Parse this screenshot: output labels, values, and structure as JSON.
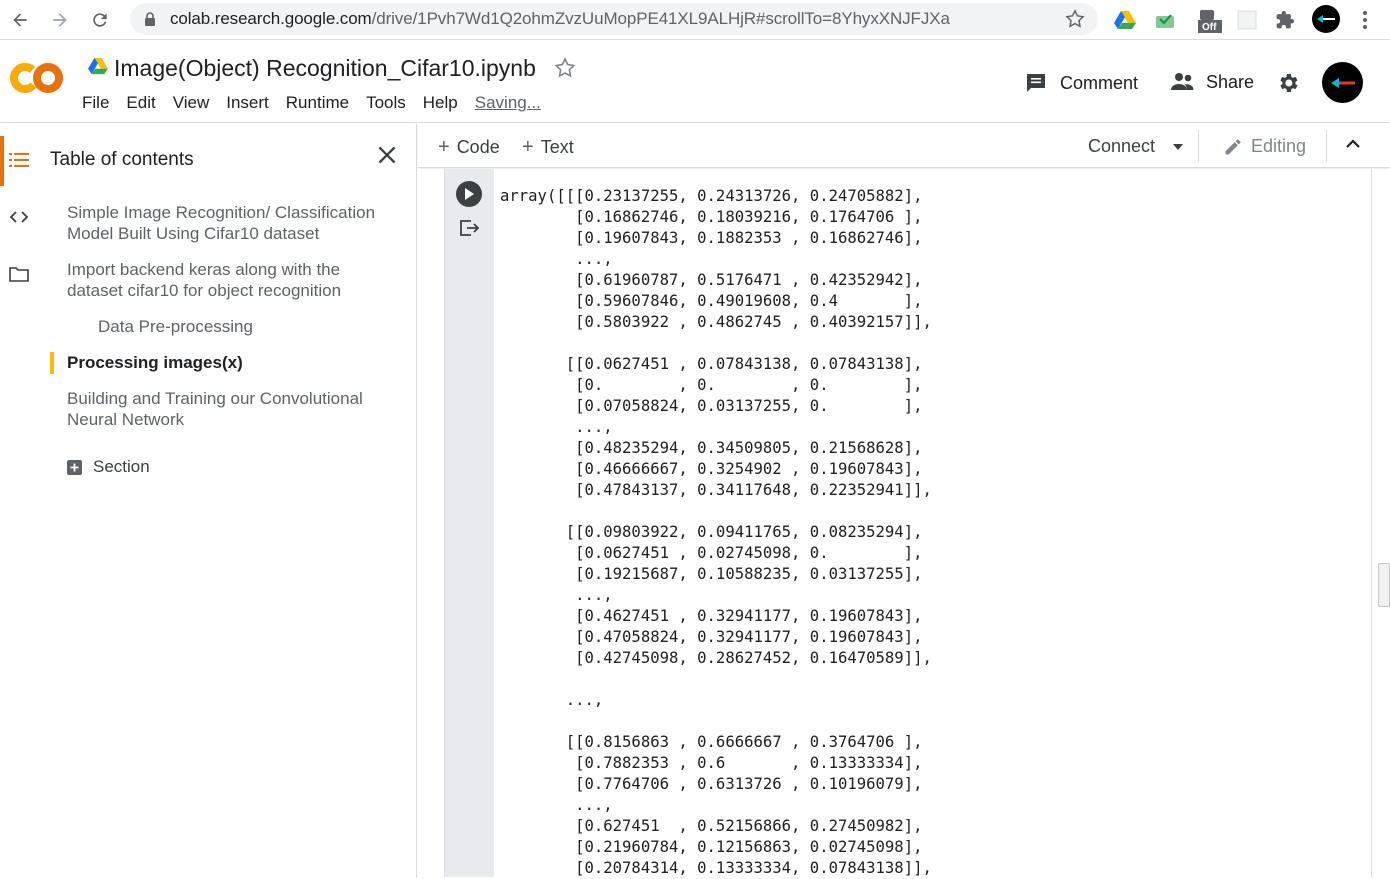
{
  "browser": {
    "url_host": "colab.research.google.com",
    "url_path": "/drive/1Pvh7Wd1Q2ohmZvzUuMopPE41XL9ALHjR#scrollTo=8YhyxXNJFJXa",
    "ext_off_label": "Off"
  },
  "header": {
    "logo_text": "CO",
    "notebook_title": "Image(Object) Recognition_Cifar10.ipynb",
    "menu": [
      "File",
      "Edit",
      "View",
      "Insert",
      "Runtime",
      "Tools",
      "Help"
    ],
    "saving_label": "Saving...",
    "comment_label": "Comment",
    "share_label": "Share"
  },
  "sidebar": {
    "title": "Table of contents",
    "items": [
      {
        "label": "Simple Image Recognition/ Classification Model Built Using Cifar10 dataset"
      },
      {
        "label": "Import backend keras along with the dataset cifar10 for object recognition"
      },
      {
        "label": "Data Pre-processing"
      },
      {
        "label": "Processing images(x)"
      },
      {
        "label": "Building and Training our Convolutional Neural Network"
      }
    ],
    "section_label": "Section"
  },
  "toolbar": {
    "code_label": "Code",
    "text_label": "Text",
    "connect_label": "Connect",
    "editing_label": "Editing"
  },
  "cell": {
    "output_lines": [
      "array([[[0.23137255, 0.24313726, 0.24705882],",
      "        [0.16862746, 0.18039216, 0.1764706 ],",
      "        [0.19607843, 0.1882353 , 0.16862746],",
      "        ...,",
      "        [0.61960787, 0.5176471 , 0.42352942],",
      "        [0.59607846, 0.49019608, 0.4       ],",
      "        [0.5803922 , 0.4862745 , 0.40392157]],",
      "",
      "       [[0.0627451 , 0.07843138, 0.07843138],",
      "        [0.        , 0.        , 0.        ],",
      "        [0.07058824, 0.03137255, 0.        ],",
      "        ...,",
      "        [0.48235294, 0.34509805, 0.21568628],",
      "        [0.46666667, 0.3254902 , 0.19607843],",
      "        [0.47843137, 0.34117648, 0.22352941]],",
      "",
      "       [[0.09803922, 0.09411765, 0.08235294],",
      "        [0.0627451 , 0.02745098, 0.        ],",
      "        [0.19215687, 0.10588235, 0.03137255],",
      "        ...,",
      "        [0.4627451 , 0.32941177, 0.19607843],",
      "        [0.47058824, 0.32941177, 0.19607843],",
      "        [0.42745098, 0.28627452, 0.16470589]],",
      "",
      "       ...,",
      "",
      "       [[0.8156863 , 0.6666667 , 0.3764706 ],",
      "        [0.7882353 , 0.6       , 0.13333334],",
      "        [0.7764706 , 0.6313726 , 0.10196079],",
      "        ...,",
      "        [0.627451  , 0.52156866, 0.27450982],",
      "        [0.21960784, 0.12156863, 0.02745098],",
      "        [0.20784314, 0.13333334, 0.07843138]],"
    ]
  },
  "colors": {
    "logo_yellow": "#f9ab00",
    "logo_orange": "#e8710a",
    "toc_active_bar": "#fbbc04"
  }
}
